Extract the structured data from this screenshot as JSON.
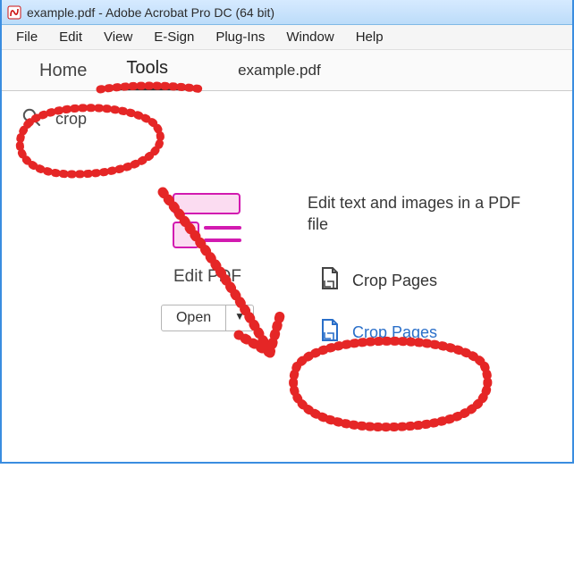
{
  "title_bar": {
    "text": "example.pdf - Adobe Acrobat Pro DC (64 bit)"
  },
  "menu": {
    "file": "File",
    "edit": "Edit",
    "view": "View",
    "esign": "E-Sign",
    "plugins": "Plug-Ins",
    "window": "Window",
    "help": "Help"
  },
  "tabs": {
    "home": "Home",
    "tools": "Tools",
    "doc": "example.pdf"
  },
  "search": {
    "value": "crop"
  },
  "tool_card": {
    "title": "Edit PDF",
    "open_label": "Open",
    "caret": "▼"
  },
  "description": "Edit text and images in a PDF file",
  "results": {
    "crop1": "Crop Pages",
    "crop2": "Crop Pages"
  },
  "colors": {
    "annotation": "#e52828",
    "link_blue": "#2a6fc9",
    "pink_fill": "#fbdcf1",
    "magenta_stroke": "#d21ab0"
  }
}
